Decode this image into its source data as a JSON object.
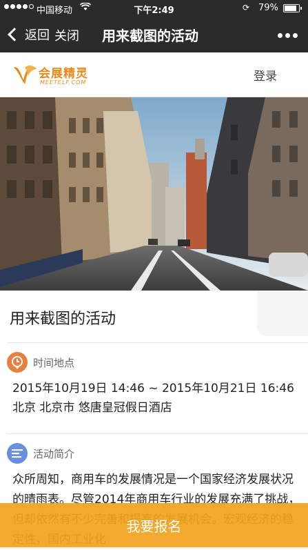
{
  "status_bar": {
    "carrier": "中国移动",
    "time": "下午2:49",
    "battery_text": "79%",
    "battery_level": 0.79,
    "signal_bars": 4
  },
  "nav": {
    "back_label": "返回",
    "close_label": "关闭",
    "title": "用来截图的活动"
  },
  "site": {
    "brand": "会展精灵",
    "brand_sub": "MEETELF.COM",
    "login_label": "登录",
    "accent": "#e88a1a"
  },
  "event": {
    "title": "用来截图的活动",
    "time_section_label": "时间地点",
    "time_range": "2015年10月19日 14:46 ~ 2015年10月21日 16:46",
    "location": "北京 北京市 悠唐皇冠假日酒店",
    "intro_section_label": "活动简介",
    "intro_text": "众所周知，商用车的发展情况是一个国家经济发展状况的晴雨表。尽管2014年商用车行业的发展充满了挑战，但却依然有不少完善和提高的发展机会。宏观经济的稳定性，国内工业化"
  },
  "footer": {
    "signup_label": "我要报名"
  }
}
